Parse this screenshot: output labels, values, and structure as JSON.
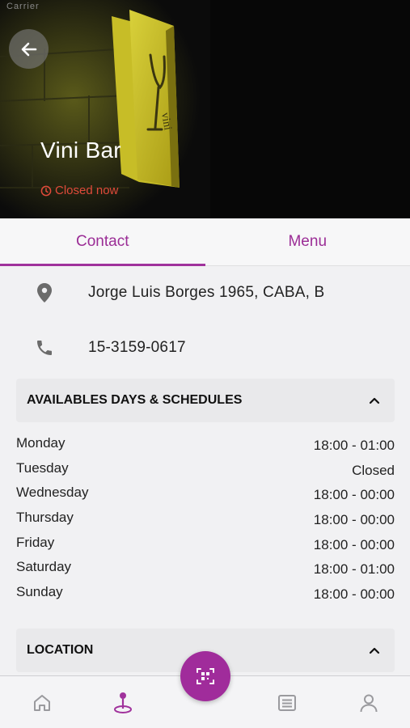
{
  "status_bar": {
    "carrier": "Carrier"
  },
  "hero": {
    "title": "Vini Bar",
    "status_text": "Closed now",
    "sign_text": "vini"
  },
  "tabs": [
    {
      "label": "Contact",
      "active": true
    },
    {
      "label": "Menu",
      "active": false
    }
  ],
  "contact": {
    "address": "Jorge Luis Borges 1965, CABA, B",
    "phone": "15-3159-0617"
  },
  "schedule_section": {
    "title": "AVAILABLES DAYS & SCHEDULES",
    "rows": [
      {
        "day": "Monday",
        "hours": "18:00 - 01:00"
      },
      {
        "day": "Tuesday",
        "hours": "Closed"
      },
      {
        "day": "Wednesday",
        "hours": "18:00 - 00:00"
      },
      {
        "day": "Thursday",
        "hours": "18:00 - 00:00"
      },
      {
        "day": "Friday",
        "hours": "18:00 - 00:00"
      },
      {
        "day": "Saturday",
        "hours": "18:00 - 01:00"
      },
      {
        "day": "Sunday",
        "hours": "18:00 - 00:00"
      }
    ]
  },
  "location_section": {
    "title": "LOCATION"
  },
  "bottom_nav": {
    "items": [
      "home-icon",
      "map-pin-icon",
      "qr-scan-icon",
      "list-icon",
      "user-icon"
    ],
    "active": "map-pin-icon"
  },
  "colors": {
    "accent": "#a0329c",
    "status_closed": "#e04a3a",
    "background": "#f1f1f3"
  }
}
